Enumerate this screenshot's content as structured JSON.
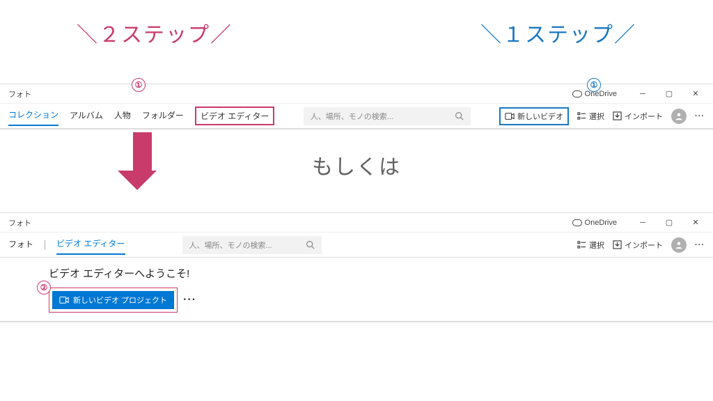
{
  "callouts": {
    "two_step": "＼２ステップ／",
    "one_step": "＼１ステップ／"
  },
  "badge_labels": {
    "one": "①",
    "two": "②"
  },
  "window1": {
    "title": "フォト",
    "onedrive": "OneDrive",
    "tabs": {
      "collection": "コレクション",
      "album": "アルバム",
      "people": "人物",
      "folder": "フォルダー",
      "video_editor": "ビデオ エディター"
    },
    "search_placeholder": "人、場所、モノの検索...",
    "actions": {
      "new_video": "新しいビデオ",
      "select": "選択",
      "import": "インポート"
    }
  },
  "center_text": "もしくは",
  "window2": {
    "title": "フォト",
    "onedrive": "OneDrive",
    "tabs": {
      "photo": "フォト",
      "video_editor": "ビデオ エディター"
    },
    "search_placeholder": "人、場所、モノの検索...",
    "actions": {
      "select": "選択",
      "import": "インポート"
    },
    "welcome_heading": "ビデオ エディターへようこそ!",
    "new_project_btn": "新しいビデオ プロジェクト"
  },
  "colors": {
    "pink": "#c93b6a",
    "blue": "#1a78c2",
    "accent": "#0078d4"
  }
}
